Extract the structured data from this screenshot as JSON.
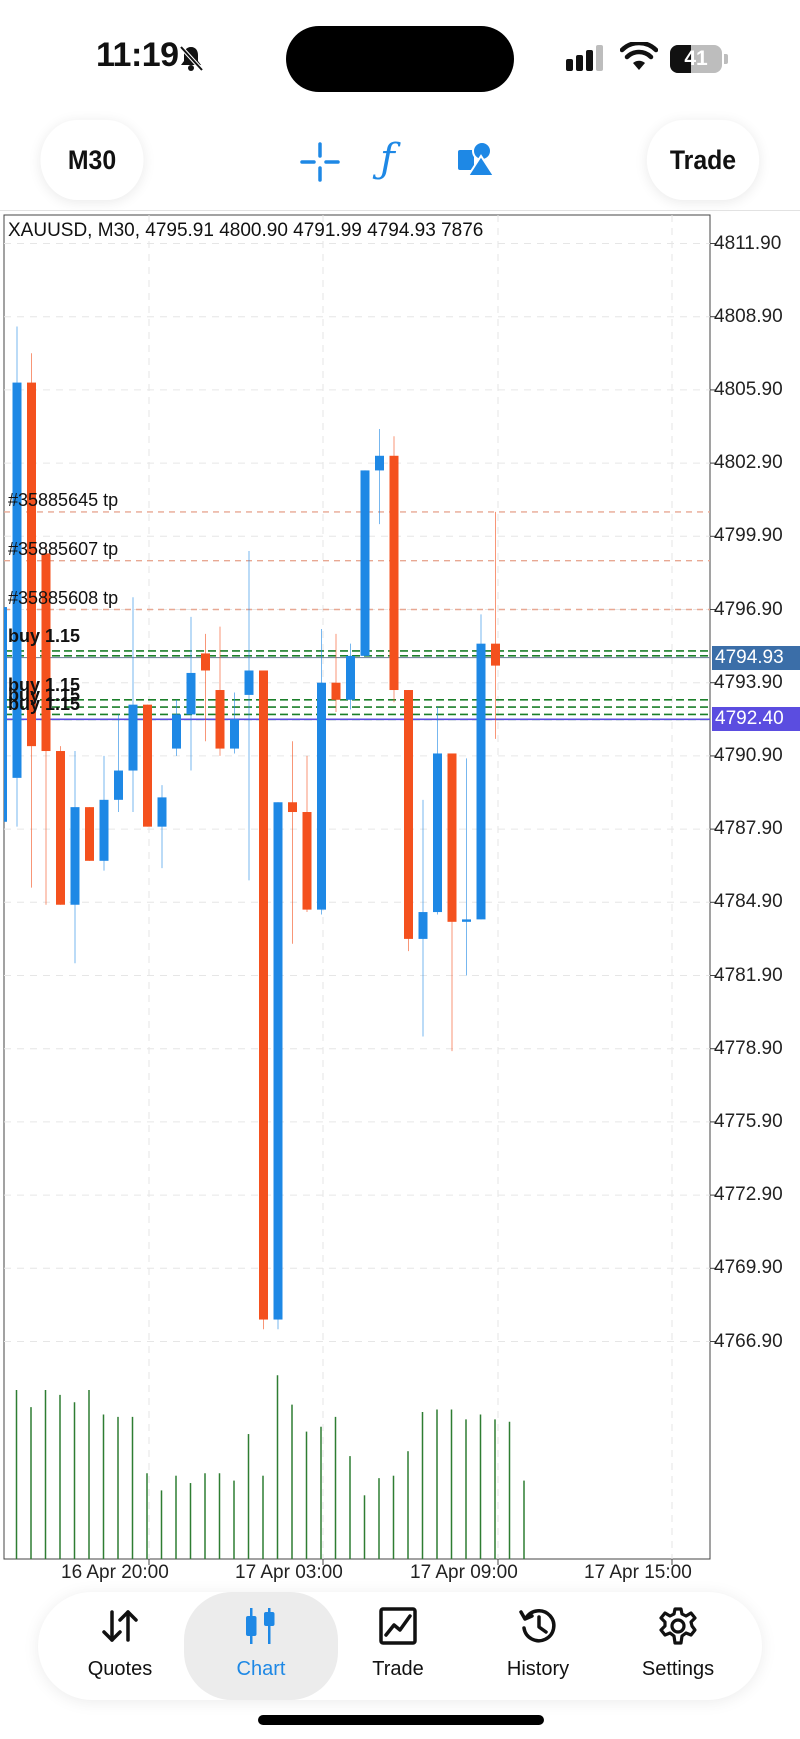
{
  "status_bar": {
    "time": "11:19",
    "battery": "41",
    "battery_level": 0.41
  },
  "toolbar": {
    "timeframe": "M30",
    "trade": "Trade",
    "accent_color": "#1e88e5"
  },
  "chart": {
    "info_line": "XAUUSD, M30, 4795.91 4800.90 4791.99 4794.93 7876",
    "bid_tag": "4794.93",
    "ask_tag": "4792.40",
    "bid_color": "#3b6ea8",
    "ask_color": "#5b4de0",
    "bull_color": "#1e88e5",
    "bear_color": "#f4511e",
    "volume_color": "#2e7d32",
    "price_labels": [
      "4811.90",
      "4808.90",
      "4805.90",
      "4802.90",
      "4799.90",
      "4796.90",
      "4793.90",
      "4790.90",
      "4787.90",
      "4784.90",
      "4781.90",
      "4778.90",
      "4775.90",
      "4772.90",
      "4769.90",
      "4766.90"
    ],
    "time_labels": [
      "16 Apr 20:00",
      "17 Apr 03:00",
      "17 Apr 09:00",
      "17 Apr 15:00"
    ],
    "tp_labels": [
      "#35885645 tp",
      "#35885607 tp",
      "#35885608 tp"
    ],
    "buy_labels": [
      "buy 1.15",
      "buy 1.15",
      "buy 1.15",
      "buy 1.15"
    ]
  },
  "chart_data": {
    "type": "candlestick",
    "symbol": "XAUUSD",
    "timeframe": "M30",
    "y_range": [
      4765.9,
      4813.0
    ],
    "x_ticks": [
      "16 Apr 20:00",
      "17 Apr 03:00",
      "17 Apr 09:00",
      "17 Apr 15:00"
    ],
    "candles": [
      {
        "o": 4790.0,
        "h": 4808.5,
        "l": 4788.0,
        "c": 4806.2
      },
      {
        "o": 4806.2,
        "h": 4807.4,
        "l": 4785.5,
        "c": 4791.3
      },
      {
        "o": 4799.2,
        "h": 4799.5,
        "l": 4784.8,
        "c": 4791.1
      },
      {
        "o": 4791.1,
        "h": 4791.3,
        "l": 4784.8,
        "c": 4784.8
      },
      {
        "o": 4784.8,
        "h": 4791.1,
        "l": 4782.4,
        "c": 4788.8
      },
      {
        "o": 4788.8,
        "h": 4788.8,
        "l": 4786.6,
        "c": 4786.6
      },
      {
        "o": 4786.6,
        "h": 4790.9,
        "l": 4786.2,
        "c": 4789.1
      },
      {
        "o": 4789.1,
        "h": 4792.6,
        "l": 4788.6,
        "c": 4790.3
      },
      {
        "o": 4790.3,
        "h": 4797.4,
        "l": 4788.6,
        "c": 4793.0
      },
      {
        "o": 4793.0,
        "h": 4793.0,
        "l": 4788.0,
        "c": 4788.0
      },
      {
        "o": 4788.0,
        "h": 4789.7,
        "l": 4786.3,
        "c": 4789.2
      },
      {
        "o": 4791.2,
        "h": 4793.2,
        "l": 4790.9,
        "c": 4792.6
      },
      {
        "o": 4792.6,
        "h": 4796.6,
        "l": 4790.3,
        "c": 4794.3
      },
      {
        "o": 4795.1,
        "h": 4795.9,
        "l": 4791.5,
        "c": 4794.4
      },
      {
        "o": 4793.6,
        "h": 4796.2,
        "l": 4790.9,
        "c": 4791.2
      },
      {
        "o": 4791.2,
        "h": 4793.5,
        "l": 4791.0,
        "c": 4792.4
      },
      {
        "o": 4793.4,
        "h": 4799.3,
        "l": 4785.8,
        "c": 4794.4
      },
      {
        "o": 4794.4,
        "h": 4791.0,
        "l": 4767.4,
        "c": 4767.8
      },
      {
        "o": 4767.8,
        "h": 4789.0,
        "l": 4767.4,
        "c": 4789.0
      },
      {
        "o": 4789.0,
        "h": 4791.5,
        "l": 4783.2,
        "c": 4788.6
      },
      {
        "o": 4788.6,
        "h": 4790.9,
        "l": 4784.5,
        "c": 4784.6
      },
      {
        "o": 4784.6,
        "h": 4796.1,
        "l": 4784.4,
        "c": 4793.9
      },
      {
        "o": 4793.9,
        "h": 4795.9,
        "l": 4792.7,
        "c": 4793.2
      },
      {
        "o": 4793.2,
        "h": 4795.5,
        "l": 4792.8,
        "c": 4795.0
      },
      {
        "o": 4795.0,
        "h": 4801.4,
        "l": 4795.0,
        "c": 4802.6
      },
      {
        "o": 4802.6,
        "h": 4804.3,
        "l": 4800.4,
        "c": 4803.2
      },
      {
        "o": 4803.2,
        "h": 4804.0,
        "l": 4793.1,
        "c": 4793.6
      },
      {
        "o": 4793.6,
        "h": 4791.8,
        "l": 4782.9,
        "c": 4783.4
      },
      {
        "o": 4783.4,
        "h": 4789.1,
        "l": 4779.4,
        "c": 4784.5
      },
      {
        "o": 4784.5,
        "h": 4792.9,
        "l": 4784.4,
        "c": 4791.0
      },
      {
        "o": 4791.0,
        "h": 4791.0,
        "l": 4778.8,
        "c": 4784.1
      },
      {
        "o": 4784.1,
        "h": 4790.8,
        "l": 4781.9,
        "c": 4784.2
      },
      {
        "o": 4784.2,
        "h": 4796.7,
        "l": 4784.2,
        "c": 4795.5
      },
      {
        "o": 4795.5,
        "h": 4800.9,
        "l": 4791.6,
        "c": 4794.6
      }
    ],
    "volume": [
      69,
      62,
      69,
      67,
      64,
      69,
      59,
      58,
      58,
      35,
      28,
      34,
      31,
      35,
      35,
      32,
      51,
      34,
      75,
      63,
      52,
      54,
      58,
      42,
      26,
      33,
      34,
      44,
      60,
      61,
      61,
      57,
      59,
      57,
      56,
      32
    ],
    "levels": {
      "tp": [
        4800.9,
        4798.9,
        4796.9
      ],
      "buy": [
        4795.2,
        4795.0,
        4793.2,
        4792.9,
        4792.6,
        4792.4
      ],
      "bid": 4794.93,
      "ask": 4792.4
    }
  },
  "bottom_nav": {
    "items": [
      {
        "label": "Quotes"
      },
      {
        "label": "Chart"
      },
      {
        "label": "Trade"
      },
      {
        "label": "History"
      },
      {
        "label": "Settings"
      }
    ]
  }
}
